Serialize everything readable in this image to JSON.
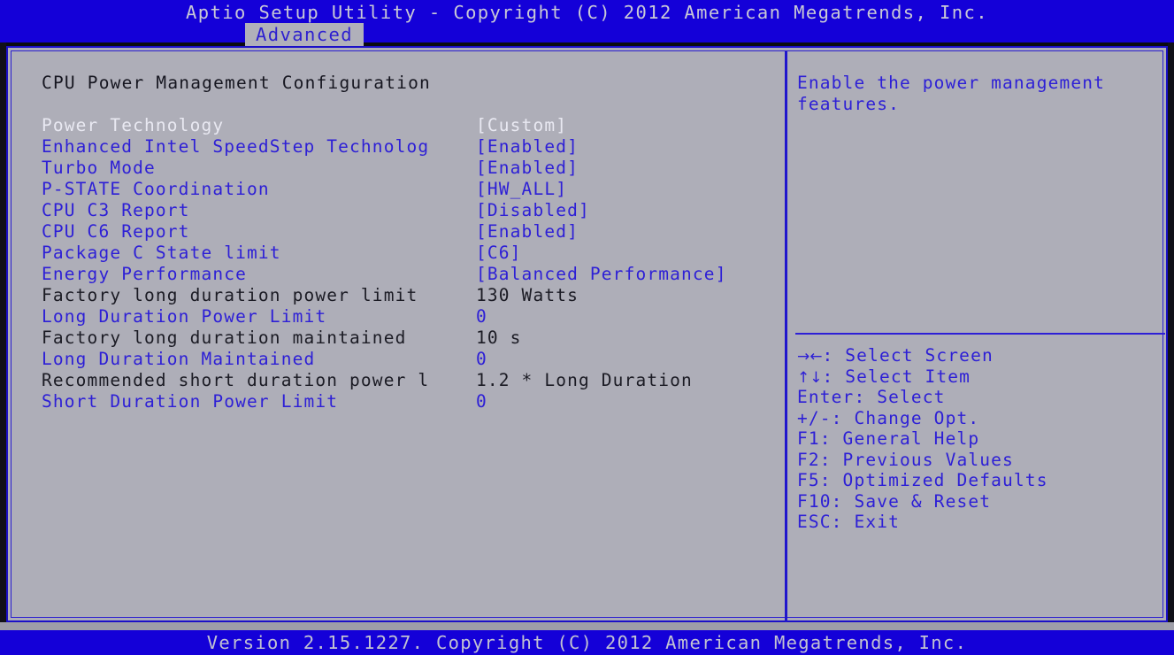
{
  "header": {
    "title": "Aptio Setup Utility - Copyright (C) 2012 American Megatrends, Inc.",
    "active_tab": "Advanced"
  },
  "footer": {
    "text": "Version 2.15.1227. Copyright (C) 2012 American Megatrends, Inc."
  },
  "colors": {
    "screen_background": "#aeaeb8",
    "band_blue": "#1400d8",
    "text_blue": "#2d1fd6",
    "text_dark": "#1b1b24",
    "text_selected": "#e9e9f2"
  },
  "main": {
    "section_title": "CPU Power Management Configuration",
    "rows": [
      {
        "label": "Power Technology",
        "value": "[Custom]",
        "label_style": "selected",
        "value_style": "selected",
        "editable": true
      },
      {
        "label": "Enhanced Intel SpeedStep Technolog",
        "value": "[Enabled]",
        "label_style": "option",
        "value_style": "option",
        "editable": true
      },
      {
        "label": "Turbo Mode",
        "value": "[Enabled]",
        "label_style": "option",
        "value_style": "option",
        "editable": true
      },
      {
        "label": "P-STATE Coordination",
        "value": "[HW_ALL]",
        "label_style": "option",
        "value_style": "option",
        "editable": true
      },
      {
        "label": "CPU C3 Report",
        "value": "[Disabled]",
        "label_style": "option",
        "value_style": "option",
        "editable": true
      },
      {
        "label": "CPU C6 Report",
        "value": "[Enabled]",
        "label_style": "option",
        "value_style": "option",
        "editable": true
      },
      {
        "label": "Package C State limit",
        "value": "[C6]",
        "label_style": "option",
        "value_style": "option",
        "editable": true
      },
      {
        "label": "Energy Performance",
        "value": "[Balanced Performance]",
        "label_style": "option",
        "value_style": "option",
        "editable": true
      },
      {
        "label": "Factory long duration power limit",
        "value": "130 Watts",
        "label_style": "info",
        "value_style": "info",
        "editable": false
      },
      {
        "label": "Long Duration Power Limit",
        "value": "0",
        "label_style": "option",
        "value_style": "option",
        "editable": true
      },
      {
        "label": "Factory long duration maintained",
        "value": "10 s",
        "label_style": "info",
        "value_style": "info",
        "editable": false
      },
      {
        "label": "Long Duration Maintained",
        "value": "0",
        "label_style": "option",
        "value_style": "option",
        "editable": true
      },
      {
        "label": "Recommended short duration power l",
        "value": "1.2 * Long Duration",
        "label_style": "info",
        "value_style": "info",
        "editable": false
      },
      {
        "label": "Short Duration Power Limit",
        "value": "0",
        "label_style": "option",
        "value_style": "option",
        "editable": true
      }
    ]
  },
  "help": {
    "description": "Enable the power management features.",
    "keys": [
      {
        "glyph": "→←",
        "text": ": Select Screen"
      },
      {
        "glyph": "↑↓",
        "text": ": Select Item"
      },
      {
        "glyph": "",
        "text": "Enter: Select"
      },
      {
        "glyph": "",
        "text": "+/-: Change Opt."
      },
      {
        "glyph": "",
        "text": "F1: General Help"
      },
      {
        "glyph": "",
        "text": "F2: Previous Values"
      },
      {
        "glyph": "",
        "text": "F5: Optimized Defaults"
      },
      {
        "glyph": "",
        "text": "F10: Save & Reset"
      },
      {
        "glyph": "",
        "text": "ESC: Exit"
      }
    ]
  }
}
